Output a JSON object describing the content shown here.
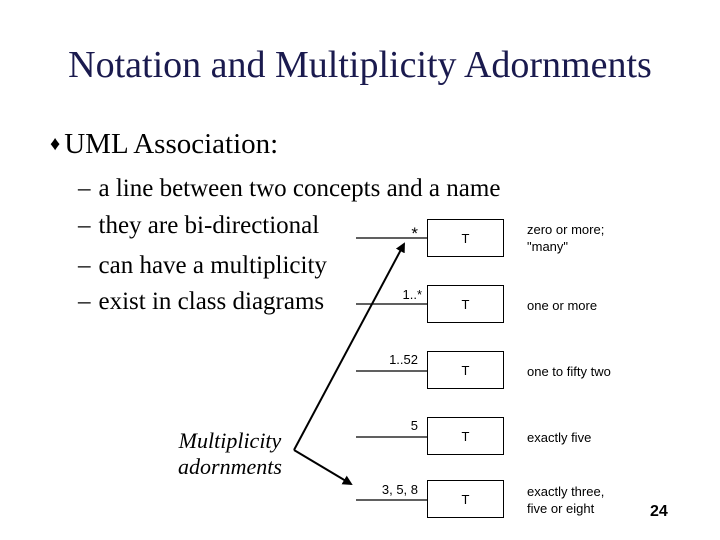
{
  "slide": {
    "title": "Notation and Multiplicity Adornments",
    "bullet": {
      "icon": "diamond-bullet-icon",
      "symbol": "♦",
      "text": "UML Association:"
    },
    "sub_bullets": [
      {
        "dash": "–",
        "text": "a line between two concepts and a name"
      },
      {
        "dash": "–",
        "text": "they are bi-directional"
      },
      {
        "dash": "–",
        "text": "can have a multiplicity"
      },
      {
        "dash": "–",
        "text": "exist in class diagrams"
      }
    ],
    "multiplicities": [
      {
        "label": "*",
        "class": "T",
        "description": [
          "zero or more;",
          "\"many\""
        ]
      },
      {
        "label": "1..*",
        "class": "T",
        "description": [
          "one or more"
        ]
      },
      {
        "label": "1..52",
        "class": "T",
        "description": [
          "one to fifty two"
        ]
      },
      {
        "label": "5",
        "class": "T",
        "description": [
          "exactly five"
        ]
      },
      {
        "label": "3, 5, 8",
        "class": "T",
        "description": [
          "exactly three,",
          "five or eight"
        ]
      }
    ],
    "annotation": [
      "Multiplicity",
      "adornments"
    ],
    "page_number": "24"
  }
}
